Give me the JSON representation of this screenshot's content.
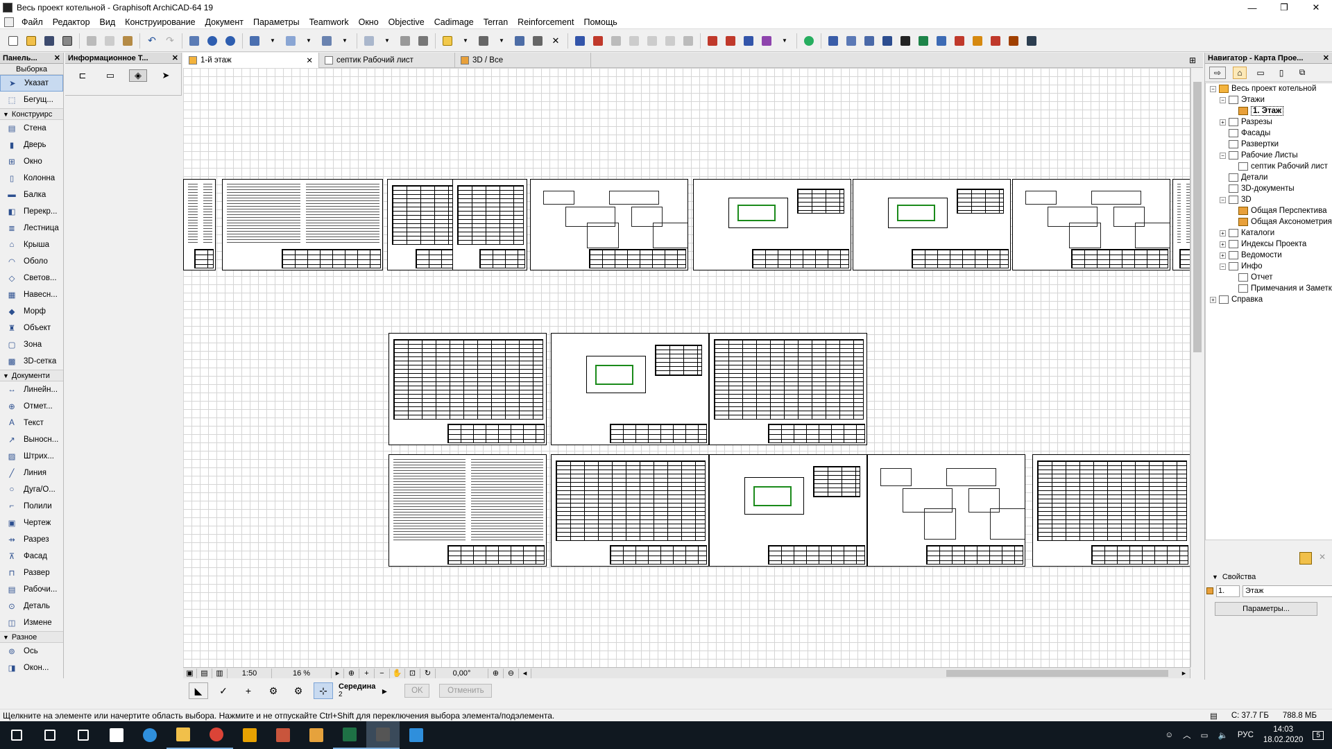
{
  "window": {
    "title": "Весь проект котельной - Graphisoft ArchiCAD-64 19",
    "minimize": "—",
    "maximize": "❐",
    "close": "✕"
  },
  "menu": [
    "Файл",
    "Редактор",
    "Вид",
    "Конструирование",
    "Документ",
    "Параметры",
    "Teamwork",
    "Окно",
    "Objective",
    "Cadimage",
    "Terran",
    "Reinforcement",
    "Помощь"
  ],
  "toolbox": {
    "title": "Панель...",
    "close": "✕",
    "selection_group": "Выборка",
    "selection_tools": [
      {
        "label": "Указат",
        "icon": "arrow-pointer-icon",
        "selected": true
      },
      {
        "label": "Бегущ...",
        "icon": "marquee-icon",
        "selected": false
      }
    ],
    "groups": [
      {
        "name": "Конструирс",
        "tools": [
          {
            "label": "Стена",
            "icon": "wall-icon"
          },
          {
            "label": "Дверь",
            "icon": "door-icon"
          },
          {
            "label": "Окно",
            "icon": "window-icon"
          },
          {
            "label": "Колонна",
            "icon": "column-icon"
          },
          {
            "label": "Балка",
            "icon": "beam-icon"
          },
          {
            "label": "Перекр...",
            "icon": "slab-icon"
          },
          {
            "label": "Лестница",
            "icon": "stair-icon"
          },
          {
            "label": "Крыша",
            "icon": "roof-icon"
          },
          {
            "label": "Оболо",
            "icon": "shell-icon"
          },
          {
            "label": "Светов...",
            "icon": "skylight-icon"
          },
          {
            "label": "Навесн...",
            "icon": "curtain-wall-icon"
          },
          {
            "label": "Морф",
            "icon": "morph-icon"
          },
          {
            "label": "Объект",
            "icon": "object-icon"
          },
          {
            "label": "Зона",
            "icon": "zone-icon"
          },
          {
            "label": "3D-сетка",
            "icon": "mesh-icon"
          }
        ]
      },
      {
        "name": "Документи",
        "tools": [
          {
            "label": "Линейн...",
            "icon": "dimension-icon"
          },
          {
            "label": "Отмет...",
            "icon": "level-dimension-icon"
          },
          {
            "label": "Текст",
            "icon": "text-icon"
          },
          {
            "label": "Выносн...",
            "icon": "label-icon"
          },
          {
            "label": "Штрих...",
            "icon": "fill-icon"
          },
          {
            "label": "Линия",
            "icon": "line-icon"
          },
          {
            "label": "Дуга/О...",
            "icon": "arc-icon"
          },
          {
            "label": "Полили",
            "icon": "polyline-icon"
          },
          {
            "label": "Чертеж",
            "icon": "drawing-icon"
          },
          {
            "label": "Разрез",
            "icon": "section-icon"
          },
          {
            "label": "Фасад",
            "icon": "elevation-icon"
          },
          {
            "label": "Развер",
            "icon": "interior-elevation-icon"
          },
          {
            "label": "Рабочи...",
            "icon": "worksheet-icon"
          },
          {
            "label": "Деталь",
            "icon": "detail-icon"
          },
          {
            "label": "Измене",
            "icon": "change-icon"
          }
        ]
      },
      {
        "name": "Разное",
        "tools": [
          {
            "label": "Ось",
            "icon": "grid-axis-icon"
          },
          {
            "label": "Окон...",
            "icon": "opening-icon"
          }
        ]
      }
    ]
  },
  "info_panel": {
    "title": "Информационное Т...",
    "close": "✕"
  },
  "tabs": [
    {
      "label": "1-й этаж",
      "active": true,
      "close": "✕"
    },
    {
      "label": "септик Рабочий лист",
      "active": false
    },
    {
      "label": "3D / Все",
      "active": false
    }
  ],
  "canvas_bar": {
    "scale": "1:50",
    "zoom": "16 %",
    "angle": "0,00°"
  },
  "control_bar": {
    "snap_label": "Середина",
    "snap_value": "2",
    "ok": "OK",
    "cancel": "Отменить"
  },
  "status": {
    "message": "Щелкните на элементе или начертите область выбора. Нажмите и не отпускайте Ctrl+Shift для переключения выбора элемента/подэлемента.",
    "disk": "С: 37.7 ГБ",
    "memory": "788.8 МБ"
  },
  "navigator": {
    "title": "Навигатор - Карта Прое...",
    "close": "✕",
    "tree": [
      {
        "label": "Весь проект котельной",
        "level": 0,
        "exp": "−",
        "icon": "project-home-icon"
      },
      {
        "label": "Этажи",
        "level": 1,
        "exp": "−",
        "icon": "stories-icon"
      },
      {
        "label": "1. Этаж",
        "level": 2,
        "exp": "",
        "icon": "story-icon",
        "selected": true
      },
      {
        "label": "Разрезы",
        "level": 1,
        "exp": "+",
        "icon": "sections-icon"
      },
      {
        "label": "Фасады",
        "level": 1,
        "exp": "",
        "icon": "elevations-icon"
      },
      {
        "label": "Развертки",
        "level": 1,
        "exp": "",
        "icon": "interior-elevations-icon"
      },
      {
        "label": "Рабочие Листы",
        "level": 1,
        "exp": "−",
        "icon": "worksheets-icon"
      },
      {
        "label": "септик Рабочий лист",
        "level": 2,
        "exp": "",
        "icon": "worksheet-icon"
      },
      {
        "label": "Детали",
        "level": 1,
        "exp": "",
        "icon": "details-icon"
      },
      {
        "label": "3D-документы",
        "level": 1,
        "exp": "",
        "icon": "3d-documents-icon"
      },
      {
        "label": "3D",
        "level": 1,
        "exp": "−",
        "icon": "3d-icon"
      },
      {
        "label": "Общая Перспектива",
        "level": 2,
        "exp": "",
        "icon": "perspective-icon"
      },
      {
        "label": "Общая Аксонометрия",
        "level": 2,
        "exp": "",
        "icon": "axonometry-icon"
      },
      {
        "label": "Каталоги",
        "level": 1,
        "exp": "+",
        "icon": "schedules-icon"
      },
      {
        "label": "Индексы Проекта",
        "level": 1,
        "exp": "+",
        "icon": "project-indexes-icon"
      },
      {
        "label": "Ведомости",
        "level": 1,
        "exp": "+",
        "icon": "lists-icon"
      },
      {
        "label": "Инфо",
        "level": 1,
        "exp": "−",
        "icon": "info-icon"
      },
      {
        "label": "Отчет",
        "level": 2,
        "exp": "",
        "icon": "report-icon"
      },
      {
        "label": "Примечания и Заметки",
        "level": 2,
        "exp": "",
        "icon": "notes-icon"
      },
      {
        "label": "Справка",
        "level": 0,
        "exp": "+",
        "icon": "help-icon"
      }
    ],
    "properties": {
      "header": "Свойства",
      "id": "1.",
      "name": "Этаж",
      "button": "Параметры..."
    }
  },
  "taskbar": {
    "apps": [
      "start-icon",
      "search-icon",
      "task-view-icon",
      "mail-icon",
      "edge-icon",
      "explorer-icon",
      "chrome-icon",
      "autocad-icon",
      "powerpoint-icon",
      "media-icon",
      "excel-icon",
      "archicad-icon",
      "onedrive-icon"
    ],
    "lang": "РУС",
    "time": "14:03",
    "date": "18.02.2020",
    "notifications": "5"
  },
  "colors": {
    "accent": "#7aa3d6",
    "selection": "#c8daf0",
    "taskbar": "#101820",
    "drawing_green": "#1a8a1a"
  }
}
